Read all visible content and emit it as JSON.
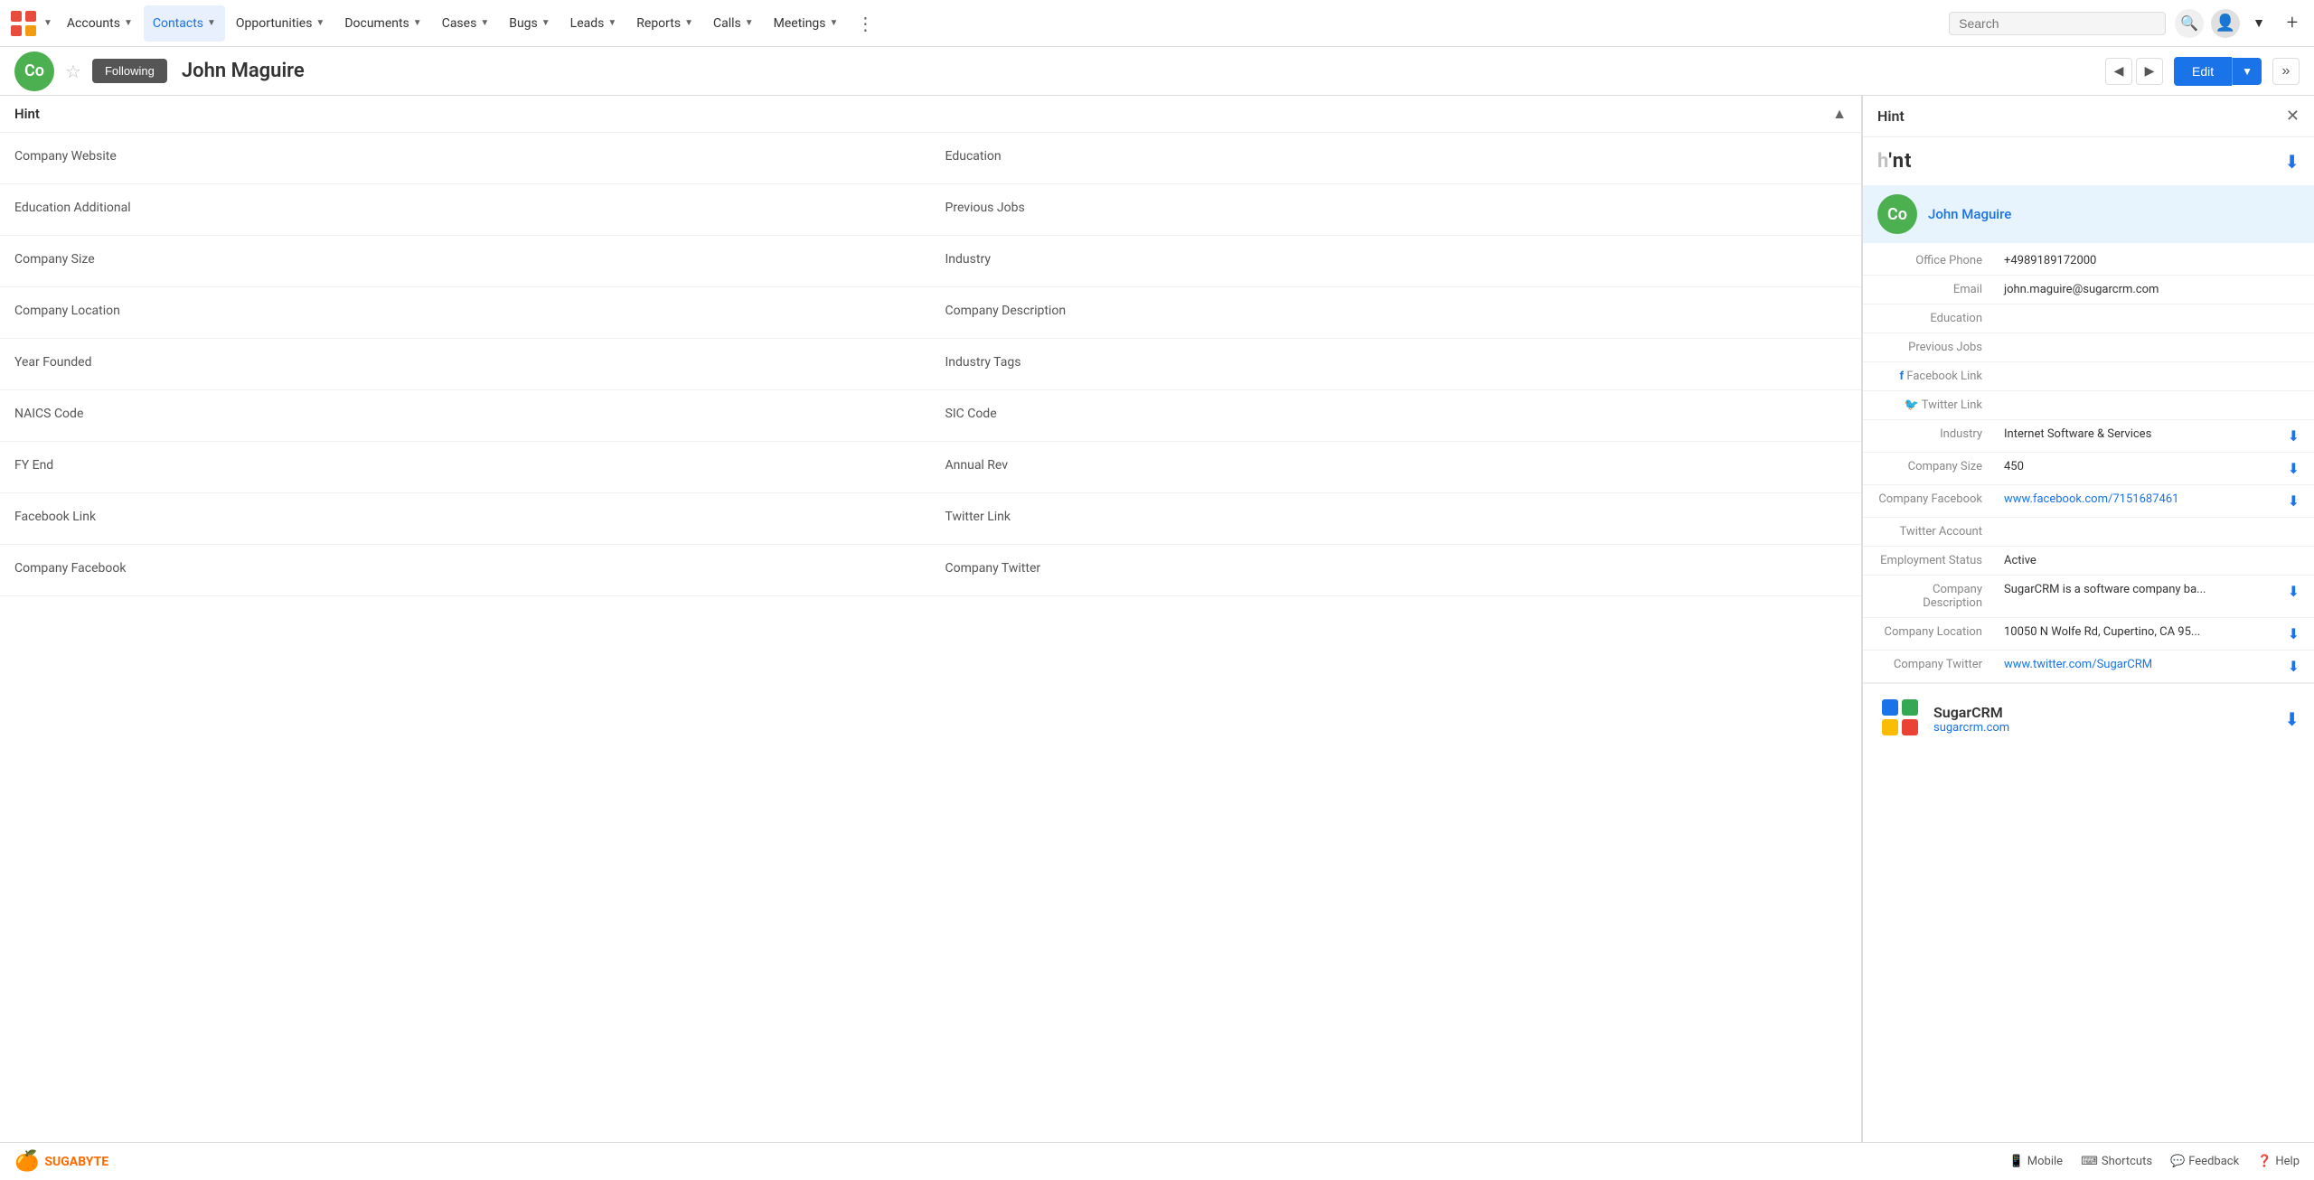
{
  "nav": {
    "logo_text": "🧱",
    "items": [
      {
        "label": "Accounts",
        "active": false,
        "id": "accounts"
      },
      {
        "label": "Contacts",
        "active": true,
        "id": "contacts"
      },
      {
        "label": "Opportunities",
        "active": false,
        "id": "opportunities"
      },
      {
        "label": "Documents",
        "active": false,
        "id": "documents"
      },
      {
        "label": "Cases",
        "active": false,
        "id": "cases"
      },
      {
        "label": "Bugs",
        "active": false,
        "id": "bugs"
      },
      {
        "label": "Leads",
        "active": false,
        "id": "leads"
      },
      {
        "label": "Reports",
        "active": false,
        "id": "reports"
      },
      {
        "label": "Calls",
        "active": false,
        "id": "calls"
      },
      {
        "label": "Meetings",
        "active": false,
        "id": "meetings"
      }
    ],
    "search_placeholder": "Search"
  },
  "subheader": {
    "avatar_initials": "Co",
    "following_label": "Following",
    "contact_name": "John Maguire",
    "edit_label": "Edit"
  },
  "hint_section": {
    "title": "Hint",
    "fields_left": [
      {
        "label": "Company Website",
        "value": ""
      },
      {
        "label": "Education Additional",
        "value": ""
      },
      {
        "label": "Company Size",
        "value": ""
      },
      {
        "label": "Company Location",
        "value": ""
      },
      {
        "label": "Year Founded",
        "value": ""
      },
      {
        "label": "NAICS Code",
        "value": ""
      },
      {
        "label": "FY End",
        "value": ""
      },
      {
        "label": "Facebook Link",
        "value": ""
      },
      {
        "label": "Company Facebook",
        "value": ""
      }
    ],
    "fields_right": [
      {
        "label": "Education",
        "value": ""
      },
      {
        "label": "Previous Jobs",
        "value": ""
      },
      {
        "label": "Industry",
        "value": ""
      },
      {
        "label": "Company Description",
        "value": ""
      },
      {
        "label": "Industry Tags",
        "value": ""
      },
      {
        "label": "SIC Code",
        "value": ""
      },
      {
        "label": "Annual Rev",
        "value": ""
      },
      {
        "label": "Twitter Link",
        "value": ""
      },
      {
        "label": "Company Twitter",
        "value": ""
      }
    ]
  },
  "hint_panel": {
    "title": "Hint",
    "logo_display": "h'nt",
    "contact": {
      "avatar_initials": "Co",
      "name": "John Maguire"
    },
    "info_rows": [
      {
        "label": "Office Phone",
        "value": "+4989189172000",
        "is_link": false,
        "has_download": false
      },
      {
        "label": "Email",
        "value": "john.maguire@sugarcrm.com",
        "is_link": false,
        "has_download": false
      },
      {
        "label": "Education",
        "value": "",
        "is_link": false,
        "has_download": false
      },
      {
        "label": "Previous Jobs",
        "value": "",
        "is_link": false,
        "has_download": false
      },
      {
        "label": "Facebook Link",
        "value": "",
        "is_link": false,
        "has_download": false,
        "has_icon": "facebook"
      },
      {
        "label": "Twitter Link",
        "value": "",
        "is_link": false,
        "has_download": false,
        "has_icon": "twitter"
      },
      {
        "label": "Industry",
        "value": "Internet Software & Services",
        "is_link": false,
        "has_download": true
      },
      {
        "label": "Company Size",
        "value": "450",
        "is_link": false,
        "has_download": true
      },
      {
        "label": "Company Facebook",
        "value": "www.facebook.com/7151687461",
        "is_link": true,
        "has_download": true
      },
      {
        "label": "Twitter Account",
        "value": "",
        "is_link": false,
        "has_download": false
      },
      {
        "label": "Employment Status",
        "value": "Active",
        "is_link": false,
        "has_download": false
      },
      {
        "label": "Company Description",
        "value": "SugarCRM is a software company ba...",
        "is_link": false,
        "has_download": true
      },
      {
        "label": "Company Location",
        "value": "10050 N Wolfe Rd, Cupertino, CA 95...",
        "is_link": false,
        "has_download": true
      },
      {
        "label": "Company Twitter",
        "value": "www.twitter.com/SugarCRM",
        "is_link": true,
        "has_download": true
      }
    ],
    "company": {
      "name": "SugarCRM",
      "url": "sugarcrm.com",
      "has_download": true
    }
  },
  "footer": {
    "logo_text": "SUGABYTE",
    "links": [
      {
        "label": "Mobile",
        "icon": "📱"
      },
      {
        "label": "Shortcuts",
        "icon": "⌨"
      },
      {
        "label": "Feedback",
        "icon": "💬"
      },
      {
        "label": "Help",
        "icon": "❓"
      }
    ]
  }
}
